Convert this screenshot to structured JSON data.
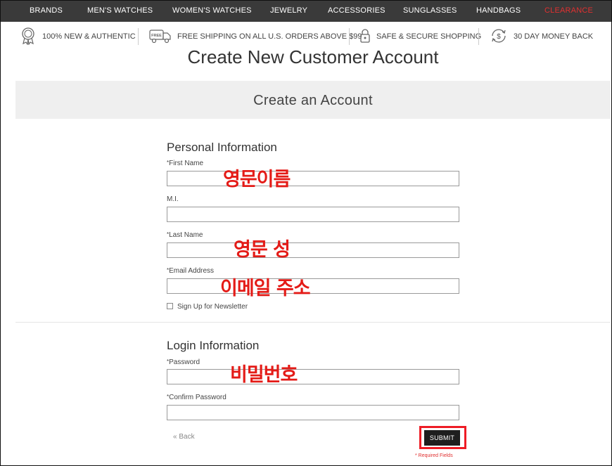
{
  "top_nav": {
    "items": [
      "BRANDS",
      "MEN'S WATCHES",
      "WOMEN'S WATCHES",
      "JEWELRY",
      "ACCESSORIES",
      "SUNGLASSES",
      "HANDBAGS",
      "CLEARANCE"
    ],
    "clearance_color": "#e03030"
  },
  "benefits": [
    {
      "icon": "ribbon-badge-icon",
      "text": "100% NEW & AUTHENTIC"
    },
    {
      "icon": "free-shipping-truck-icon",
      "text": "FREE SHIPPING ON ALL U.S. ORDERS ABOVE $99"
    },
    {
      "icon": "padlock-icon",
      "text": "SAFE & SECURE SHOPPING"
    },
    {
      "icon": "money-back-icon",
      "text": "30 DAY MONEY BACK"
    }
  ],
  "page": {
    "title": "Create New Customer Account",
    "panel_title": "Create an Account"
  },
  "personal": {
    "title": "Personal Information",
    "first_name_label": "First Name",
    "mi_label": "M.I.",
    "last_name_label": "Last Name",
    "email_label": "Email Address",
    "newsletter_label": "Sign Up for Newsletter"
  },
  "login": {
    "title": "Login Information",
    "password_label": "Password",
    "confirm_label": "Confirm Password"
  },
  "annotations": {
    "first_name": "영문이름",
    "last_name": "영문 성",
    "email": "이메일 주소",
    "password": "비밀번호",
    "color": "#e41b17"
  },
  "actions": {
    "back_label": "« Back",
    "submit_label": "SUBMIT",
    "required_note": "* Required Fields"
  },
  "free_icon_text": "FREE",
  "money_icon_text": "$",
  "required_marker": "*"
}
